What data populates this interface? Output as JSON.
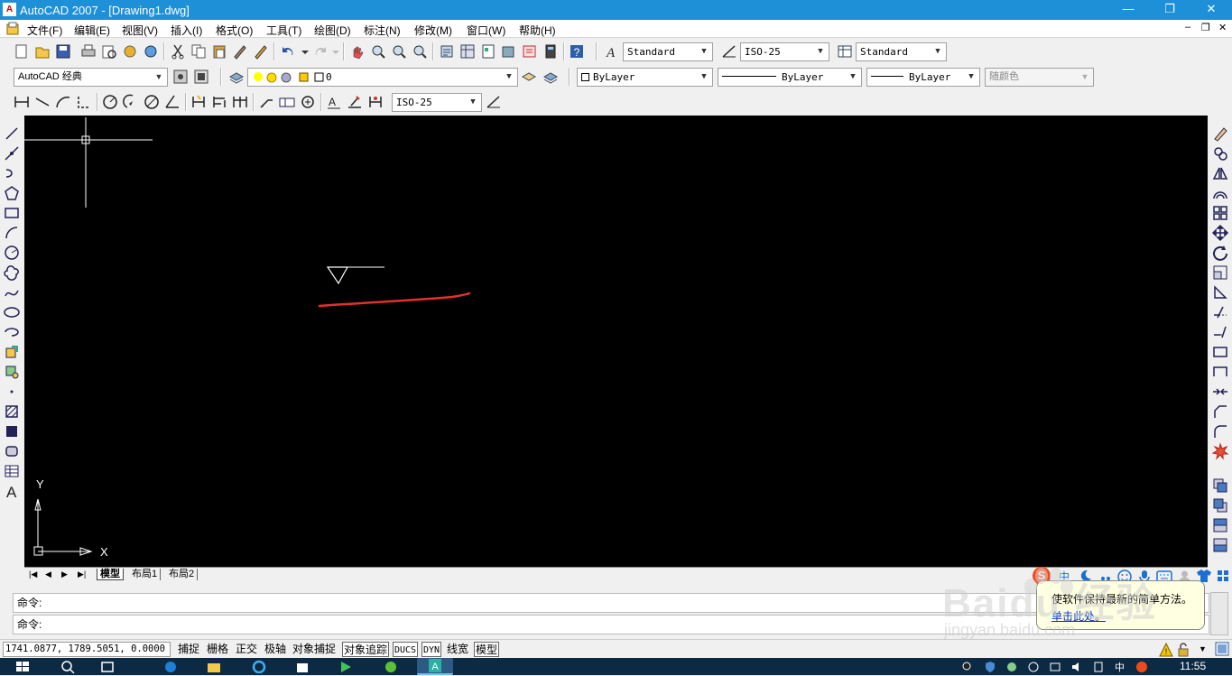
{
  "window": {
    "title": "AutoCAD 2007 - [Drawing1.dwg]",
    "minimize": "—",
    "restore": "❐",
    "close": "✕",
    "doc_minimize": "–",
    "doc_restore": "❐",
    "doc_close": "✕"
  },
  "menu": [
    "文件(F)",
    "编辑(E)",
    "视图(V)",
    "插入(I)",
    "格式(O)",
    "工具(T)",
    "绘图(D)",
    "标注(N)",
    "修改(M)",
    "窗口(W)",
    "帮助(H)"
  ],
  "toolbar1": {
    "text_style": "Standard",
    "dim_style": "ISO-25",
    "table_style": "Standard"
  },
  "toolbar2": {
    "workspace": "AutoCAD 经典",
    "layer": "0",
    "color": "ByLayer",
    "linetype": "ByLayer",
    "lineweight": "ByLayer",
    "plot_style": "随颜色"
  },
  "toolbar3": {
    "dim_style": "ISO-25"
  },
  "canvas": {
    "ucs_y": "Y",
    "ucs_x": "X"
  },
  "layout_tabs": [
    "模型",
    "布局1",
    "布局2"
  ],
  "nav_arrows": [
    "|◀",
    "◀",
    "▶",
    "▶|"
  ],
  "command": {
    "line1_label": "命令:",
    "line2_label": "命令:"
  },
  "status": {
    "coordinates": "1741.0877, 1789.5051, 0.0000",
    "buttons": [
      {
        "label": "捕捉",
        "on": false
      },
      {
        "label": "栅格",
        "on": false
      },
      {
        "label": "正交",
        "on": false
      },
      {
        "label": "极轴",
        "on": false
      },
      {
        "label": "对象捕捉",
        "on": false
      },
      {
        "label": "对象追踪",
        "on": true
      },
      {
        "label": "DUCS",
        "on": true
      },
      {
        "label": "DYN",
        "on": true
      },
      {
        "label": "线宽",
        "on": false
      },
      {
        "label": "模型",
        "on": true
      }
    ]
  },
  "balloon": {
    "text": "使软件保持最新的简单方法。",
    "link": "单击此处。"
  },
  "taskbar": {
    "clock": "11:55"
  },
  "watermark": {
    "brand": "Baidu 经验",
    "url": "jingyan.baidu.com"
  },
  "colors": {
    "titlebar": "#1e90d8",
    "canvas": "#000000",
    "red_stroke": "#e62e2e",
    "taskbar": "#0c2a44"
  }
}
